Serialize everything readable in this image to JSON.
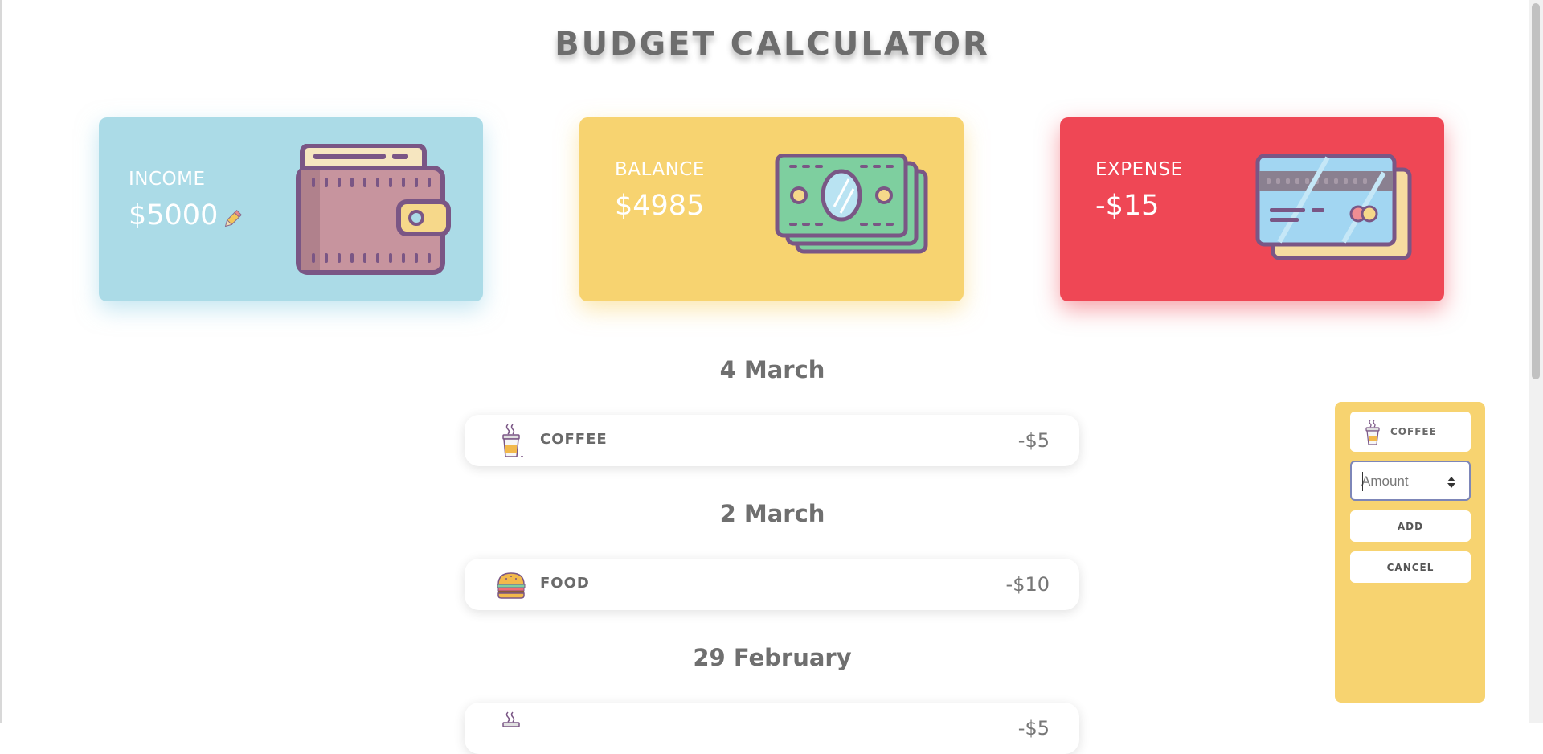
{
  "app": {
    "title": "BUDGET CALCULATOR"
  },
  "cards": {
    "income": {
      "label": "INCOME",
      "value": "$5000",
      "color": "#abdbe7"
    },
    "balance": {
      "label": "BALANCE",
      "value": "$4985",
      "color": "#f7d370"
    },
    "expense": {
      "label": "EXPENSE",
      "value": "-$15",
      "color": "#ef4755"
    }
  },
  "icons": {
    "income": "wallet-icon",
    "edit": "pencil-icon",
    "balance": "money-bills-icon",
    "expense": "credit-cards-icon",
    "coffee": "coffee-cup-icon",
    "food": "burger-icon"
  },
  "days": [
    {
      "date": "4 March",
      "transactions": [
        {
          "category": "COFFEE",
          "amount": "-$5"
        }
      ]
    },
    {
      "date": "2 March",
      "transactions": [
        {
          "category": "FOOD",
          "amount": "-$10"
        }
      ]
    },
    {
      "date": "29 February",
      "transactions": [
        {
          "category": "",
          "amount": "-$5"
        }
      ]
    }
  ],
  "add_panel": {
    "category": "COFFEE",
    "amount_placeholder": "Amount",
    "amount_value": "",
    "add_label": "ADD",
    "cancel_label": "CANCEL",
    "color": "#f7d370"
  }
}
